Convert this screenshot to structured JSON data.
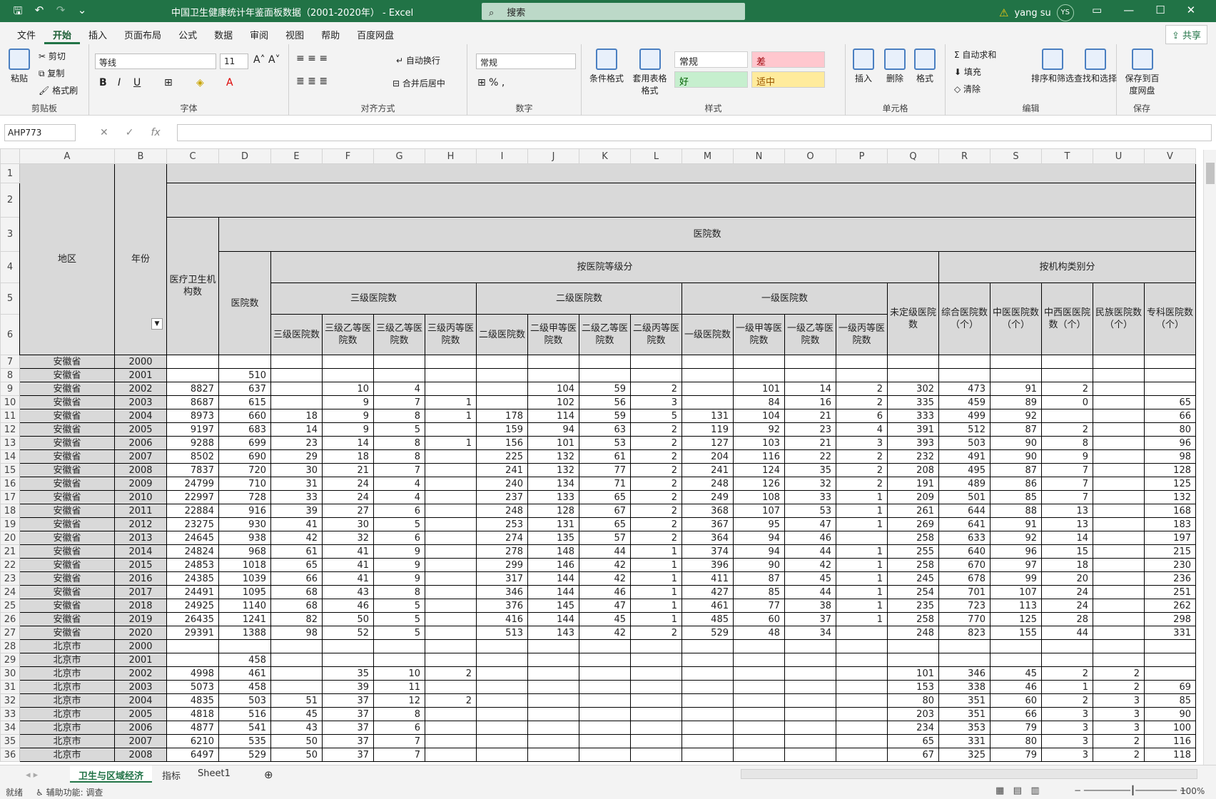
{
  "window": {
    "title": "中国卫生健康统计年鉴面板数据（2001-2020年） - Excel",
    "search_placeholder": "搜索",
    "user_name": "yang su",
    "user_initials": "YS"
  },
  "tabs": [
    "文件",
    "开始",
    "插入",
    "页面布局",
    "公式",
    "数据",
    "审阅",
    "视图",
    "帮助",
    "百度网盘"
  ],
  "share_label": "共享",
  "ribbon": {
    "clipboard": {
      "paste": "粘贴",
      "cut": "剪切",
      "copy": "复制",
      "format_painter": "格式刷",
      "label": "剪贴板"
    },
    "font": {
      "name": "等线",
      "size": "11",
      "bold": "B",
      "italic": "I",
      "underline": "U",
      "label": "字体"
    },
    "alignment": {
      "wrap": "自动换行",
      "merge": "合并后居中",
      "label": "对齐方式"
    },
    "number": {
      "format": "常规",
      "label": "数字"
    },
    "styles": {
      "conditional": "条件格式",
      "table": "套用表格格式",
      "normal": "常规",
      "bad": "差",
      "good": "好",
      "neutral": "适中",
      "label": "样式"
    },
    "cells": {
      "insert": "插入",
      "delete": "删除",
      "format": "格式",
      "label": "单元格"
    },
    "editing": {
      "autosum": "自动求和",
      "fill": "填充",
      "clear": "清除",
      "sort": "排序和筛选",
      "find": "查找和选择",
      "label": "编辑"
    },
    "save": {
      "save_baidu": "保存到百度网盘",
      "label": "保存"
    }
  },
  "formula_bar": {
    "name_box": "AHP773",
    "value": ""
  },
  "columns": [
    "A",
    "B",
    "C",
    "D",
    "E",
    "F",
    "G",
    "H",
    "I",
    "J",
    "K",
    "L",
    "M",
    "N",
    "O",
    "P",
    "Q",
    "R",
    "S",
    "T",
    "U",
    "V"
  ],
  "headers": {
    "region": "地区",
    "year": "年份",
    "institutions": "医疗卫生机构数",
    "hospitals_group": "医院数",
    "by_level": "按医院等级分",
    "by_type": "按机构类别分",
    "hospitals": "医院数",
    "tier3": "三级医院数",
    "tier2": "二级医院数",
    "tier1": "一级医院数",
    "unrated": "未定级医院数",
    "e": "三级医院数",
    "f": "三级乙等医院数",
    "g": "三级乙等医院数",
    "h": "三级丙等医院数",
    "i": "二级医院数",
    "j": "二级甲等医院数",
    "k": "二级乙等医院数",
    "l": "二级丙等医院数",
    "m": "一级医院数",
    "n": "一级甲等医院数",
    "o": "一级乙等医院数",
    "p": "一级丙等医院数",
    "r": "综合医院数（个）",
    "s": "中医医院数（个）",
    "t": "中西医医院数（个）",
    "u": "民族医院数（个）",
    "v": "专科医院数（个）"
  },
  "rows": [
    {
      "n": 7,
      "c": [
        "安徽省",
        "2000",
        "",
        "",
        "",
        "",
        "",
        "",
        "",
        "",
        "",
        "",
        "",
        "",
        "",
        "",
        "",
        "",
        "",
        "",
        "",
        ""
      ]
    },
    {
      "n": 8,
      "c": [
        "安徽省",
        "2001",
        "",
        "510",
        "",
        "",
        "",
        "",
        "",
        "",
        "",
        "",
        "",
        "",
        "",
        "",
        "",
        "",
        "",
        "",
        "",
        ""
      ]
    },
    {
      "n": 9,
      "c": [
        "安徽省",
        "2002",
        "8827",
        "637",
        "",
        "10",
        "4",
        "",
        "",
        "104",
        "59",
        "2",
        "",
        "101",
        "14",
        "2",
        "302",
        "473",
        "91",
        "2",
        "",
        ""
      ]
    },
    {
      "n": 10,
      "c": [
        "安徽省",
        "2003",
        "8687",
        "615",
        "",
        "9",
        "7",
        "1",
        "",
        "102",
        "56",
        "3",
        "",
        "84",
        "16",
        "2",
        "335",
        "459",
        "89",
        "0",
        "",
        "65"
      ]
    },
    {
      "n": 11,
      "c": [
        "安徽省",
        "2004",
        "8973",
        "660",
        "18",
        "9",
        "8",
        "1",
        "178",
        "114",
        "59",
        "5",
        "131",
        "104",
        "21",
        "6",
        "333",
        "499",
        "92",
        "",
        "",
        "66"
      ]
    },
    {
      "n": 12,
      "c": [
        "安徽省",
        "2005",
        "9197",
        "683",
        "14",
        "9",
        "5",
        "",
        "159",
        "94",
        "63",
        "2",
        "119",
        "92",
        "23",
        "4",
        "391",
        "512",
        "87",
        "2",
        "",
        "80"
      ]
    },
    {
      "n": 13,
      "c": [
        "安徽省",
        "2006",
        "9288",
        "699",
        "23",
        "14",
        "8",
        "1",
        "156",
        "101",
        "53",
        "2",
        "127",
        "103",
        "21",
        "3",
        "393",
        "503",
        "90",
        "8",
        "",
        "96"
      ]
    },
    {
      "n": 14,
      "c": [
        "安徽省",
        "2007",
        "8502",
        "690",
        "29",
        "18",
        "8",
        "",
        "225",
        "132",
        "61",
        "2",
        "204",
        "116",
        "22",
        "2",
        "232",
        "491",
        "90",
        "9",
        "",
        "98"
      ]
    },
    {
      "n": 15,
      "c": [
        "安徽省",
        "2008",
        "7837",
        "720",
        "30",
        "21",
        "7",
        "",
        "241",
        "132",
        "77",
        "2",
        "241",
        "124",
        "35",
        "2",
        "208",
        "495",
        "87",
        "7",
        "",
        "128"
      ]
    },
    {
      "n": 16,
      "c": [
        "安徽省",
        "2009",
        "24799",
        "710",
        "31",
        "24",
        "4",
        "",
        "240",
        "134",
        "71",
        "2",
        "248",
        "126",
        "32",
        "2",
        "191",
        "489",
        "86",
        "7",
        "",
        "125"
      ]
    },
    {
      "n": 17,
      "c": [
        "安徽省",
        "2010",
        "22997",
        "728",
        "33",
        "24",
        "4",
        "",
        "237",
        "133",
        "65",
        "2",
        "249",
        "108",
        "33",
        "1",
        "209",
        "501",
        "85",
        "7",
        "",
        "132"
      ]
    },
    {
      "n": 18,
      "c": [
        "安徽省",
        "2011",
        "22884",
        "916",
        "39",
        "27",
        "6",
        "",
        "248",
        "128",
        "67",
        "2",
        "368",
        "107",
        "53",
        "1",
        "261",
        "644",
        "88",
        "13",
        "",
        "168"
      ]
    },
    {
      "n": 19,
      "c": [
        "安徽省",
        "2012",
        "23275",
        "930",
        "41",
        "30",
        "5",
        "",
        "253",
        "131",
        "65",
        "2",
        "367",
        "95",
        "47",
        "1",
        "269",
        "641",
        "91",
        "13",
        "",
        "183"
      ]
    },
    {
      "n": 20,
      "c": [
        "安徽省",
        "2013",
        "24645",
        "938",
        "42",
        "32",
        "6",
        "",
        "274",
        "135",
        "57",
        "2",
        "364",
        "94",
        "46",
        "",
        "258",
        "633",
        "92",
        "14",
        "",
        "197"
      ]
    },
    {
      "n": 21,
      "c": [
        "安徽省",
        "2014",
        "24824",
        "968",
        "61",
        "41",
        "9",
        "",
        "278",
        "148",
        "44",
        "1",
        "374",
        "94",
        "44",
        "1",
        "255",
        "640",
        "96",
        "15",
        "",
        "215"
      ]
    },
    {
      "n": 22,
      "c": [
        "安徽省",
        "2015",
        "24853",
        "1018",
        "65",
        "41",
        "9",
        "",
        "299",
        "146",
        "42",
        "1",
        "396",
        "90",
        "42",
        "1",
        "258",
        "670",
        "97",
        "18",
        "",
        "230"
      ]
    },
    {
      "n": 23,
      "c": [
        "安徽省",
        "2016",
        "24385",
        "1039",
        "66",
        "41",
        "9",
        "",
        "317",
        "144",
        "42",
        "1",
        "411",
        "87",
        "45",
        "1",
        "245",
        "678",
        "99",
        "20",
        "",
        "236"
      ]
    },
    {
      "n": 24,
      "c": [
        "安徽省",
        "2017",
        "24491",
        "1095",
        "68",
        "43",
        "8",
        "",
        "346",
        "144",
        "46",
        "1",
        "427",
        "85",
        "44",
        "1",
        "254",
        "701",
        "107",
        "24",
        "",
        "251"
      ]
    },
    {
      "n": 25,
      "c": [
        "安徽省",
        "2018",
        "24925",
        "1140",
        "68",
        "46",
        "5",
        "",
        "376",
        "145",
        "47",
        "1",
        "461",
        "77",
        "38",
        "1",
        "235",
        "723",
        "113",
        "24",
        "",
        "262"
      ]
    },
    {
      "n": 26,
      "c": [
        "安徽省",
        "2019",
        "26435",
        "1241",
        "82",
        "50",
        "5",
        "",
        "416",
        "144",
        "45",
        "1",
        "485",
        "60",
        "37",
        "1",
        "258",
        "770",
        "125",
        "28",
        "",
        "298"
      ]
    },
    {
      "n": 27,
      "c": [
        "安徽省",
        "2020",
        "29391",
        "1388",
        "98",
        "52",
        "5",
        "",
        "513",
        "143",
        "42",
        "2",
        "529",
        "48",
        "34",
        "",
        "248",
        "823",
        "155",
        "44",
        "",
        "331"
      ]
    },
    {
      "n": 28,
      "c": [
        "北京市",
        "2000",
        "",
        "",
        "",
        "",
        "",
        "",
        "",
        "",
        "",
        "",
        "",
        "",
        "",
        "",
        "",
        "",
        "",
        "",
        "",
        ""
      ]
    },
    {
      "n": 29,
      "c": [
        "北京市",
        "2001",
        "",
        "458",
        "",
        "",
        "",
        "",
        "",
        "",
        "",
        "",
        "",
        "",
        "",
        "",
        "",
        "",
        "",
        "",
        "",
        ""
      ]
    },
    {
      "n": 30,
      "c": [
        "北京市",
        "2002",
        "4998",
        "461",
        "",
        "35",
        "10",
        "2",
        "",
        "",
        "",
        "",
        "",
        "",
        "",
        "",
        "101",
        "346",
        "45",
        "2",
        "2",
        ""
      ]
    },
    {
      "n": 31,
      "c": [
        "北京市",
        "2003",
        "5073",
        "458",
        "",
        "39",
        "11",
        "",
        "",
        "",
        "",
        "",
        "",
        "",
        "",
        "",
        "153",
        "338",
        "46",
        "1",
        "2",
        "69"
      ]
    },
    {
      "n": 32,
      "c": [
        "北京市",
        "2004",
        "4835",
        "503",
        "51",
        "37",
        "12",
        "2",
        "",
        "",
        "",
        "",
        "",
        "",
        "",
        "",
        "80",
        "351",
        "60",
        "2",
        "3",
        "85"
      ]
    },
    {
      "n": 33,
      "c": [
        "北京市",
        "2005",
        "4818",
        "516",
        "45",
        "37",
        "8",
        "",
        "",
        "",
        "",
        "",
        "",
        "",
        "",
        "",
        "203",
        "351",
        "66",
        "3",
        "3",
        "90"
      ]
    },
    {
      "n": 34,
      "c": [
        "北京市",
        "2006",
        "4877",
        "541",
        "43",
        "37",
        "6",
        "",
        "",
        "",
        "",
        "",
        "",
        "",
        "",
        "",
        "234",
        "353",
        "79",
        "3",
        "3",
        "100"
      ]
    },
    {
      "n": 35,
      "c": [
        "北京市",
        "2007",
        "6210",
        "535",
        "50",
        "37",
        "7",
        "",
        "",
        "",
        "",
        "",
        "",
        "",
        "",
        "",
        "65",
        "331",
        "80",
        "3",
        "2",
        "116"
      ]
    },
    {
      "n": 36,
      "c": [
        "北京市",
        "2008",
        "6497",
        "529",
        "50",
        "37",
        "7",
        "",
        "",
        "",
        "",
        "",
        "",
        "",
        "",
        "",
        "67",
        "325",
        "79",
        "3",
        "2",
        "118"
      ]
    }
  ],
  "sheets": [
    "卫生与区域经济",
    "指标",
    "Sheet1"
  ],
  "status": {
    "ready": "就绪",
    "accessibility": "辅助功能: 调查",
    "zoom": "100%"
  }
}
